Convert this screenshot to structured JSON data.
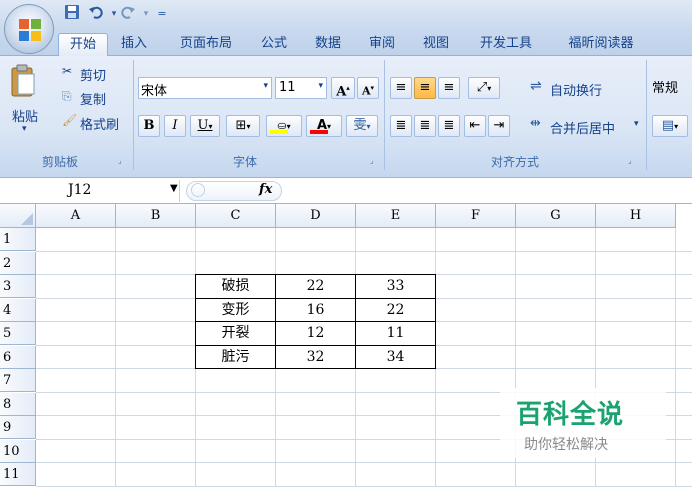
{
  "quick_access": {
    "save_icon": "save-icon",
    "undo_icon": "undo-icon",
    "redo_icon": "redo-icon",
    "customize_icon": "customize-icon"
  },
  "tabs": [
    {
      "label": "开始",
      "active": true
    },
    {
      "label": "插入"
    },
    {
      "label": "页面布局"
    },
    {
      "label": "公式"
    },
    {
      "label": "数据"
    },
    {
      "label": "审阅"
    },
    {
      "label": "视图"
    },
    {
      "label": "开发工具"
    },
    {
      "label": "福昕阅读器"
    }
  ],
  "clipboard": {
    "paste": "粘贴",
    "cut": "剪切",
    "copy": "复制",
    "format_painter": "格式刷",
    "label": "剪贴板"
  },
  "font": {
    "name": "宋体",
    "size": "11",
    "grow": "A",
    "shrink": "A",
    "bold": "B",
    "italic": "I",
    "underline": "U",
    "font_color_letter": "A",
    "phonetic": "雯",
    "label": "字体",
    "fill_color": "#ffff00",
    "text_color": "#ff0000"
  },
  "alignment": {
    "wrap_text": "自动换行",
    "merge_center": "合并后居中",
    "label": "对齐方式"
  },
  "number": {
    "format": "常规"
  },
  "formula_bar": {
    "name_box": "J12",
    "fx": "fx",
    "formula": ""
  },
  "columns": [
    "A",
    "B",
    "C",
    "D",
    "E",
    "F",
    "G",
    "H"
  ],
  "rows": [
    "1",
    "2",
    "3",
    "4",
    "5",
    "6",
    "7",
    "8",
    "9",
    "10",
    "11"
  ],
  "table": [
    [
      "破损",
      "22",
      "33"
    ],
    [
      "变形",
      "16",
      "22"
    ],
    [
      "开裂",
      "12",
      "11"
    ],
    [
      "脏污",
      "32",
      "34"
    ]
  ],
  "watermark": {
    "title": "百科全说",
    "subtitle": "助你轻松解决"
  }
}
